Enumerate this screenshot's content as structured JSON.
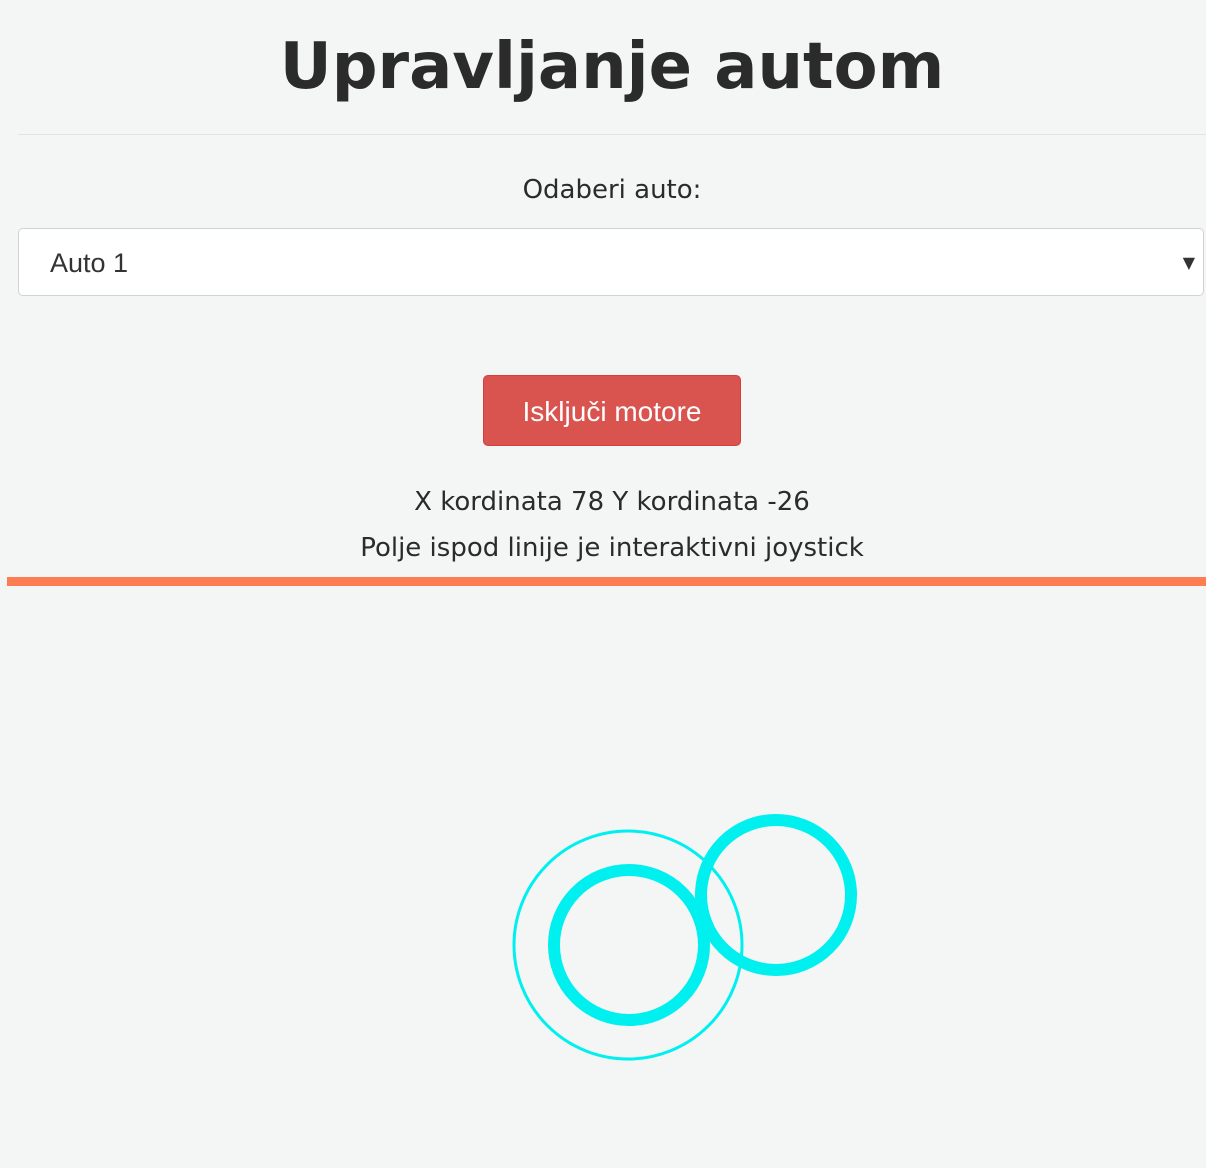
{
  "header": {
    "title": "Upravljanje autom"
  },
  "car_select": {
    "label": "Odaberi auto:",
    "selected": "Auto 1",
    "arrow_icon": "triangle-down-icon"
  },
  "motor_button": {
    "label": "Isključi motore",
    "color": "#d9534f"
  },
  "status": {
    "coordinates": "X kordinata 78 Y kordinata -26",
    "x": 78,
    "y": -26,
    "hint": "Polje ispod linije je interaktivni joystick"
  },
  "joystick": {
    "line_color": "#fb7d51",
    "ring_color": "#00f0f0"
  }
}
